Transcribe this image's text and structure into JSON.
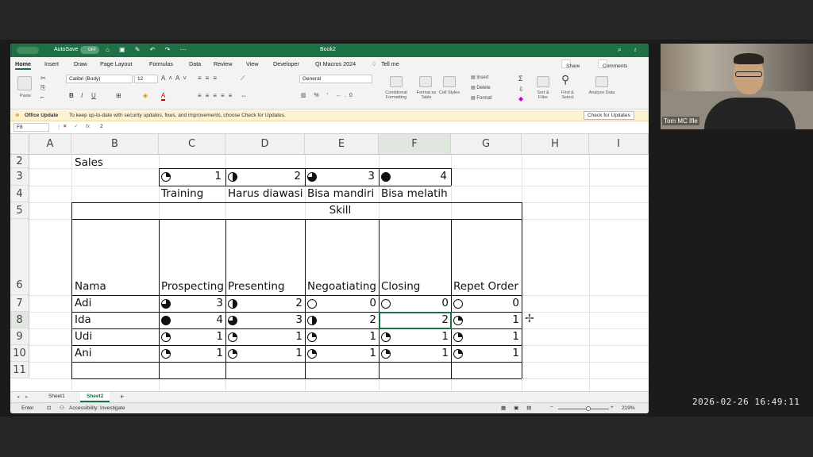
{
  "window": {
    "title": "Book2",
    "autosave_label": "AutoSave",
    "autosave_state": "OFF"
  },
  "menu": {
    "tabs": [
      "Home",
      "Insert",
      "Draw",
      "Page Layout",
      "Formulas",
      "Data",
      "Review",
      "View",
      "Developer",
      "QI Macros 2024"
    ],
    "tell_me": "Tell me",
    "share": "Share",
    "comments": "Comments"
  },
  "ribbon": {
    "paste": "Paste",
    "font_name": "Calibri (Body)",
    "font_size": "12",
    "number_format": "General",
    "conditional_formatting": "Conditional Formatting",
    "format_as_table": "Format as Table",
    "cell_styles": "Cell Styles",
    "insert": "Insert",
    "delete": "Delete",
    "format": "Format",
    "sort_filter": "Sort & Filter",
    "find_select": "Find & Select",
    "analyze_data": "Analyze Data"
  },
  "infobar": {
    "title": "Office Update",
    "message": "To keep up-to-date with security updates, fixes, and improvements, choose Check for Updates.",
    "button": "Check for Updates"
  },
  "formula": {
    "name_box": "F8",
    "fx": "fx",
    "content": "2"
  },
  "sheet": {
    "columns": [
      "A",
      "B",
      "C",
      "D",
      "E",
      "F",
      "G",
      "H",
      "I"
    ],
    "rows": [
      "2",
      "3",
      "4",
      "5",
      "6",
      "7",
      "8",
      "9",
      "10",
      "11"
    ],
    "b2": "Sales",
    "legend_values": [
      "1",
      "2",
      "3",
      "4"
    ],
    "legend_labels": [
      "Training",
      "Harus diawasi",
      "Bisa mandiri",
      "Bisa melatih"
    ],
    "skill_header": "Skill",
    "name_header": "Nama",
    "skills": [
      "Prospecting",
      "Presenting",
      "Negoatiating",
      "Closing",
      "Repet Order"
    ],
    "people": [
      {
        "name": "Adi",
        "scores": [
          "3",
          "2",
          "0",
          "0",
          "0"
        ]
      },
      {
        "name": "Ida",
        "scores": [
          "4",
          "3",
          "2",
          "2",
          "1"
        ]
      },
      {
        "name": "Udi",
        "scores": [
          "1",
          "1",
          "1",
          "1",
          "1"
        ]
      },
      {
        "name": "Ani",
        "scores": [
          "1",
          "1",
          "1",
          "1",
          "1"
        ]
      }
    ]
  },
  "sheet_tabs": [
    "Sheet1",
    "Sheet2"
  ],
  "status": {
    "mode": "Enter",
    "accessibility": "Accessibility: Investigate",
    "zoom": "219%"
  },
  "camera": {
    "name": "Tom MC Ifle"
  },
  "timestamp": "2026-02-26  16:49:11"
}
